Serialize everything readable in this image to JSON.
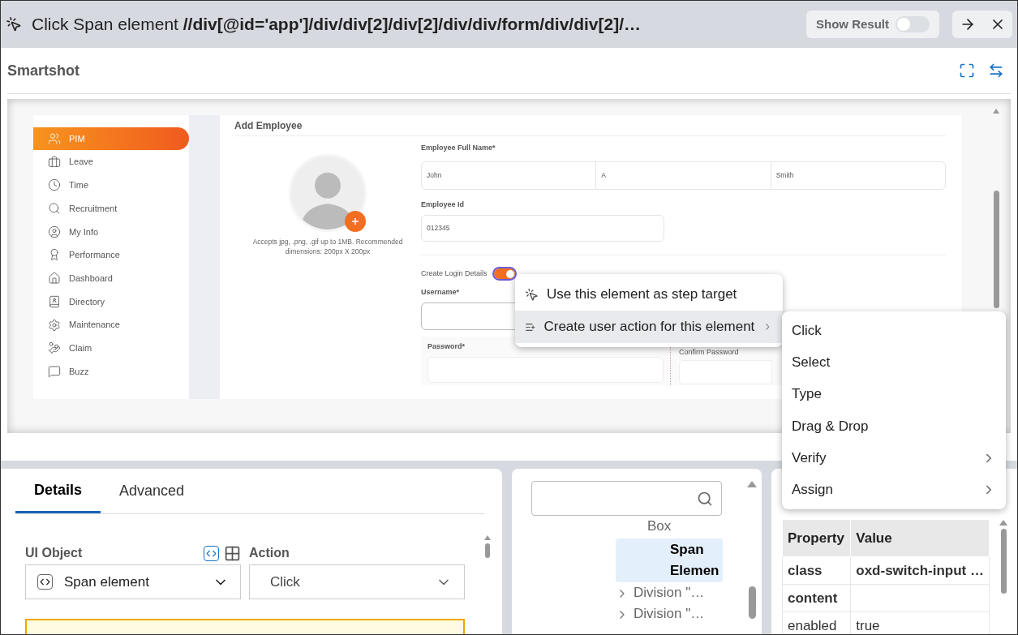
{
  "title": {
    "prefix": "Click Span element",
    "path": "//div[@id='app']/div/div[2]/div[2]/div/div/form/div/div[2]/…"
  },
  "show_result": {
    "label": "Show Result",
    "on": false
  },
  "smartshot": {
    "title": "Smartshot"
  },
  "captured_page": {
    "sidebar": [
      {
        "label": "PIM",
        "selected": true
      },
      {
        "label": "Leave",
        "selected": false
      },
      {
        "label": "Time",
        "selected": false
      },
      {
        "label": "Recruitment",
        "selected": false
      },
      {
        "label": "My Info",
        "selected": false
      },
      {
        "label": "Performance",
        "selected": false
      },
      {
        "label": "Dashboard",
        "selected": false
      },
      {
        "label": "Directory",
        "selected": false
      },
      {
        "label": "Maintenance",
        "selected": false
      },
      {
        "label": "Claim",
        "selected": false
      },
      {
        "label": "Buzz",
        "selected": false
      }
    ],
    "heading": "Add Employee",
    "photo_hint": "Accepts jpg, .png, .gif up to 1MB. Recommended dimensions: 200px X 200px",
    "full_name_label": "Employee Full Name*",
    "name_fields": [
      "John",
      "A",
      "Smith"
    ],
    "employee_id_label": "Employee Id",
    "employee_id": "012345",
    "login_label": "Create Login Details",
    "login_on": true,
    "username_label": "Username*",
    "password_label": "Password*",
    "confirm_label": "Confirm Password"
  },
  "context_menu": {
    "items": [
      {
        "label": "Use this element as step target",
        "kind": "target",
        "highlighted": false
      },
      {
        "label": "Create user action for this element",
        "kind": "submenu",
        "highlighted": true
      }
    ]
  },
  "submenu": {
    "items": [
      {
        "label": "Click",
        "has_submenu": false
      },
      {
        "label": "Select",
        "has_submenu": false
      },
      {
        "label": "Type",
        "has_submenu": false
      },
      {
        "label": "Drag & Drop",
        "has_submenu": false
      },
      {
        "label": "Verify",
        "has_submenu": true
      },
      {
        "label": "Assign",
        "has_submenu": true
      }
    ]
  },
  "details_panel": {
    "tabs": [
      {
        "label": "Details",
        "selected": true
      },
      {
        "label": "Advanced",
        "selected": false
      }
    ],
    "ui_object_label": "UI Object",
    "ui_object": "Span element",
    "action_label": "Action",
    "action": "Click"
  },
  "tree": {
    "items": [
      {
        "label": "Box",
        "selected": false,
        "expandable": false
      },
      {
        "label": "Span Elemen",
        "selected": true,
        "expandable": false
      },
      {
        "label": "Division \"…",
        "selected": false,
        "expandable": true
      },
      {
        "label": "Division \"…",
        "selected": false,
        "expandable": true
      }
    ]
  },
  "properties": {
    "columns": [
      "Property",
      "Value"
    ],
    "rows": [
      {
        "property": "class",
        "value": "oxd-switch-input …",
        "emphasized": true
      },
      {
        "property": "content",
        "value": "",
        "emphasized": true
      },
      {
        "property": "enabled",
        "value": "true",
        "emphasized": false
      }
    ]
  }
}
